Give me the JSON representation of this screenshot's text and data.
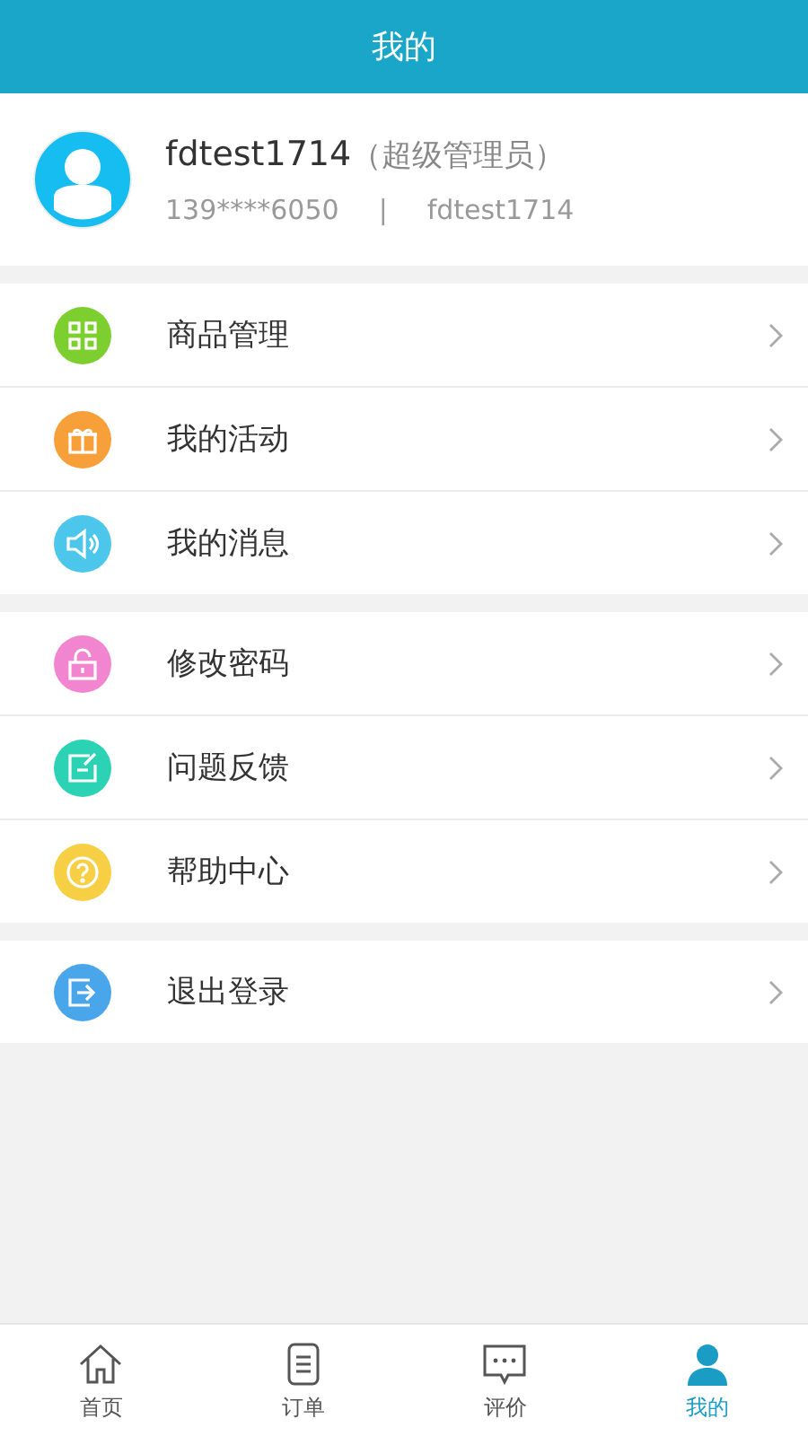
{
  "header": {
    "title": "我的"
  },
  "profile": {
    "name": "fdtest1714",
    "role": "（超级管理员）",
    "phone": "139****6050",
    "separator": "|",
    "account": "fdtest1714"
  },
  "groups": [
    [
      {
        "label": "商品管理",
        "kind": "grid",
        "color": "#7ccf2e"
      },
      {
        "label": "我的活动",
        "kind": "gift",
        "color": "#f7a03a"
      },
      {
        "label": "我的消息",
        "kind": "speaker",
        "color": "#4cc6ea"
      }
    ],
    [
      {
        "label": "修改密码",
        "kind": "lock",
        "color": "#f285cf"
      },
      {
        "label": "问题反馈",
        "kind": "edit",
        "color": "#2bd2b4"
      },
      {
        "label": "帮助中心",
        "kind": "help",
        "color": "#f6cf45"
      }
    ],
    [
      {
        "label": "退出登录",
        "kind": "exit",
        "color": "#4aa6ea"
      }
    ]
  ],
  "tabs": [
    {
      "label": "首页",
      "kind": "home",
      "selected": false
    },
    {
      "label": "订单",
      "kind": "list",
      "selected": false
    },
    {
      "label": "评价",
      "kind": "chat",
      "selected": false
    },
    {
      "label": "我的",
      "kind": "user",
      "selected": true
    }
  ]
}
